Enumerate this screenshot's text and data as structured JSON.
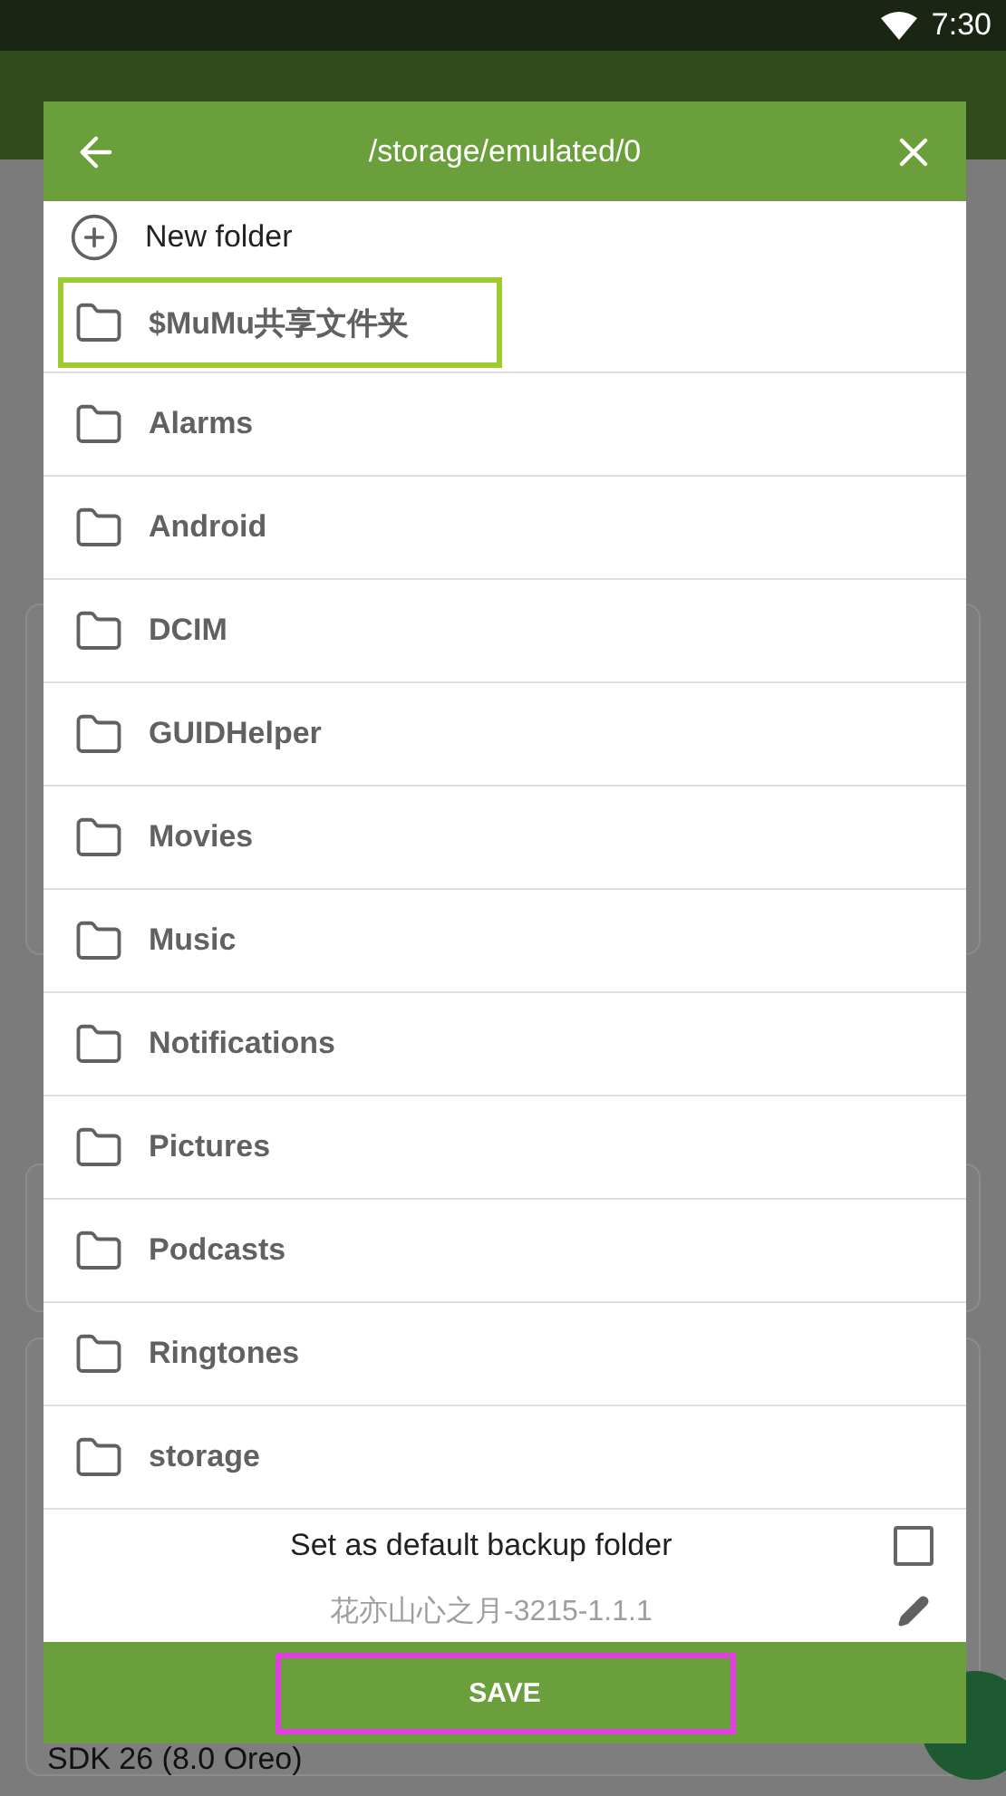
{
  "status_bar": {
    "time": "7:30"
  },
  "dialog": {
    "title": "/storage/emulated/0",
    "new_folder": "New folder",
    "folders": [
      {
        "name": "$MuMu共享文件夹",
        "highlighted": true
      },
      {
        "name": "Alarms",
        "highlighted": false
      },
      {
        "name": "Android",
        "highlighted": false
      },
      {
        "name": "DCIM",
        "highlighted": false
      },
      {
        "name": "GUIDHelper",
        "highlighted": false
      },
      {
        "name": "Movies",
        "highlighted": false
      },
      {
        "name": "Music",
        "highlighted": false
      },
      {
        "name": "Notifications",
        "highlighted": false
      },
      {
        "name": "Pictures",
        "highlighted": false
      },
      {
        "name": "Podcasts",
        "highlighted": false
      },
      {
        "name": "Ringtones",
        "highlighted": false
      },
      {
        "name": "storage",
        "highlighted": false
      }
    ],
    "default_option": {
      "label": "Set as default backup folder",
      "checked": false
    },
    "file_name": "花亦山心之月-3215-1.1.1",
    "save_button": {
      "label": "SAVE",
      "highlighted": true
    }
  },
  "background": {
    "footer_text": "SDK 26 (8.0 Oreo)"
  }
}
